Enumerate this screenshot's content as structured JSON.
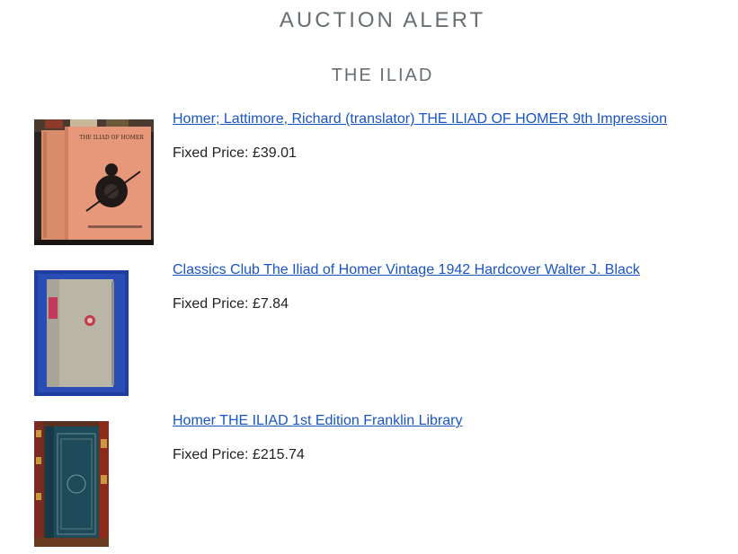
{
  "header": {
    "title": "AUCTION ALERT",
    "subtitle": "THE ILIAD"
  },
  "listings": [
    {
      "title": "Homer; Lattimore, Richard (translator) THE ILIAD OF HOMER 9th Impression",
      "price_label": "Fixed Price:",
      "price": "£39.01",
      "cover_text": "THE ILIAD OF HOMER"
    },
    {
      "title": "Classics Club The Iliad of Homer Vintage 1942 Hardcover Walter J. Black",
      "price_label": "Fixed Price:",
      "price": "£7.84"
    },
    {
      "title": "Homer THE ILIAD 1st Edition Franklin Library",
      "price_label": "Fixed Price:",
      "price": "£215.74"
    }
  ],
  "colors": {
    "heading": "#686f73",
    "link": "#1a55c4",
    "text": "#222222"
  }
}
